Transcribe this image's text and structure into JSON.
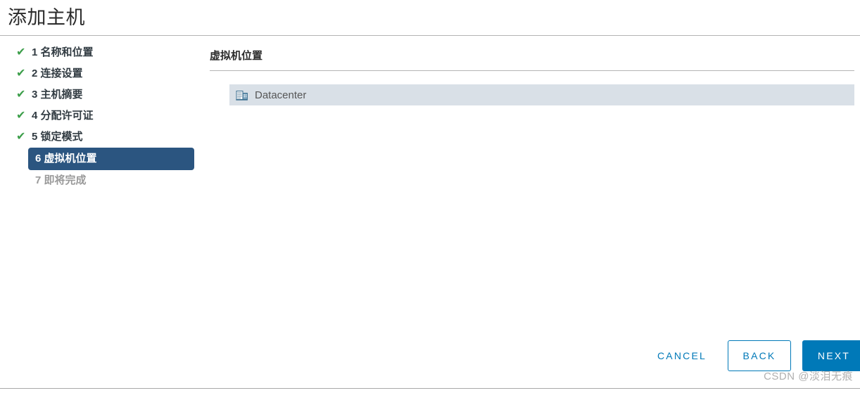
{
  "window": {
    "title": "添加主机"
  },
  "steps": [
    {
      "number": "1",
      "label": "名称和位置",
      "state": "completed",
      "check": "✔"
    },
    {
      "number": "2",
      "label": "连接设置",
      "state": "completed",
      "check": "✔"
    },
    {
      "number": "3",
      "label": "主机摘要",
      "state": "completed",
      "check": "✔"
    },
    {
      "number": "4",
      "label": "分配许可证",
      "state": "completed",
      "check": "✔"
    },
    {
      "number": "5",
      "label": "锁定模式",
      "state": "completed",
      "check": "✔"
    },
    {
      "number": "6",
      "label": "虚拟机位置",
      "state": "active",
      "check": ""
    },
    {
      "number": "7",
      "label": "即将完成",
      "state": "pending",
      "check": ""
    }
  ],
  "step_text": {
    "s1": "1 名称和位置",
    "s2": "2 连接设置",
    "s3": "3 主机摘要",
    "s4": "4 分配许可证",
    "s5": "5 锁定模式",
    "s6": "6 虚拟机位置",
    "s7": "7 即将完成"
  },
  "content": {
    "heading": "虚拟机位置",
    "locations": [
      {
        "name": "Datacenter",
        "icon": "datacenter-icon",
        "selected": true
      }
    ],
    "location_name": "Datacenter"
  },
  "footer": {
    "cancel_label": "CANCEL",
    "back_label": "BACK",
    "next_label": "NEXT"
  },
  "watermark": {
    "text": "CSDN @淡泪无痕"
  },
  "colors": {
    "accent_blue": "#0079b8",
    "active_step_bg": "#2b5580",
    "check_green": "#3c9e4a",
    "row_selected_bg": "#d9e0e7",
    "divider": "#b3b3b3",
    "pending_text": "#9a9a9a"
  }
}
